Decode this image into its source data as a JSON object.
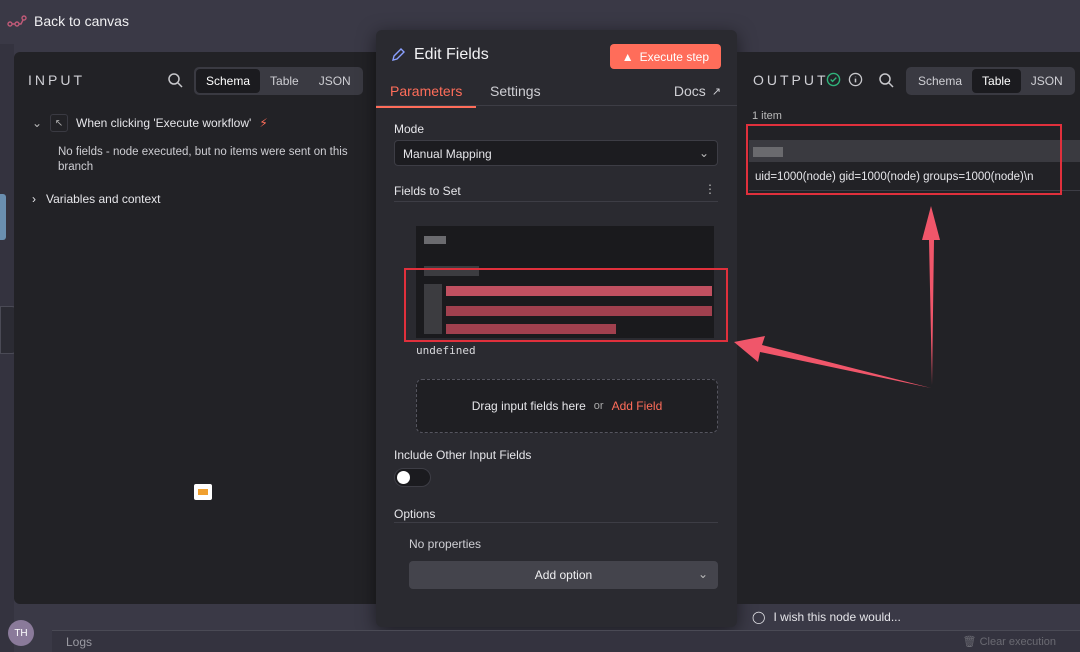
{
  "topbar": {
    "back_label": "Back to canvas"
  },
  "input_panel": {
    "title": "INPUT",
    "view_options": [
      "Schema",
      "Table",
      "JSON"
    ],
    "active_view": "Schema",
    "trigger_label": "When clicking 'Execute workflow'",
    "no_fields_text": "No fields - node executed, but no items were sent on this branch",
    "variables_label": "Variables and context"
  },
  "node": {
    "title": "Edit Fields",
    "execute_label": "Execute step",
    "tabs": [
      "Parameters",
      "Settings"
    ],
    "active_tab": "Parameters",
    "docs_label": "Docs",
    "mode_label": "Mode",
    "mode_value": "Manual Mapping",
    "fields_label": "Fields to Set",
    "field_value_text": "undefined",
    "drop_text": "Drag input fields here",
    "drop_or": "or",
    "add_field_label": "Add Field",
    "include_label": "Include Other Input Fields",
    "include_enabled": false,
    "options_label": "Options",
    "no_properties_text": "No properties",
    "add_option_label": "Add option"
  },
  "output_panel": {
    "title": "OUTPUT",
    "view_options": [
      "Schema",
      "Table",
      "JSON"
    ],
    "active_view": "Table",
    "items_count": "1 item",
    "cell_value": "uid=1000(node) gid=1000(node) groups=1000(node)\\n"
  },
  "feedback_text": "I wish this node would...",
  "bottom": {
    "logs_label": "Logs",
    "clear_label": "Clear execution"
  },
  "colors": {
    "accent": "#ff6d5a",
    "annotation": "#e0303c",
    "panel_bg": "#222226",
    "canvas_bg": "#3a3946"
  },
  "icons": [
    "flow-icon",
    "search-icon",
    "cursor-icon",
    "bolt-icon",
    "pencil-icon",
    "flask-icon",
    "external-link-icon",
    "check-circle-icon",
    "info-icon",
    "lightbulb-icon",
    "trash-icon"
  ]
}
